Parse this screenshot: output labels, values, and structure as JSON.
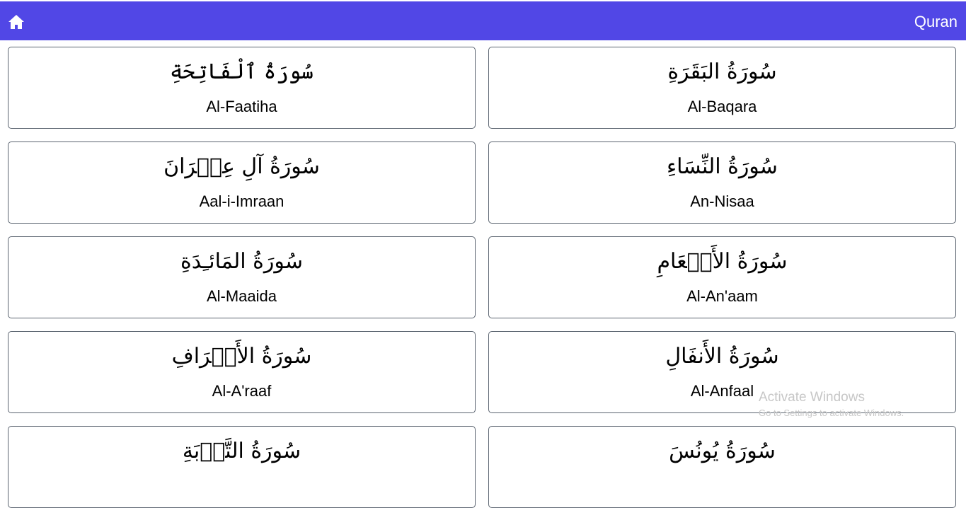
{
  "header": {
    "home_icon": "home-icon",
    "title": "Quran",
    "background": "#5147e6"
  },
  "surahs": [
    {
      "arabic": "سُورَةُ ٱلْفَاتِحَةِ",
      "name": "Al-Faatiha"
    },
    {
      "arabic": "سُورَةُ البَقَرَةِ",
      "name": "Al-Baqara"
    },
    {
      "arabic": "سُورَةُ آلِ عِمۡرَانَ",
      "name": "Aal-i-Imraan"
    },
    {
      "arabic": "سُورَةُ النِّسَاءِ",
      "name": "An-Nisaa"
    },
    {
      "arabic": "سُورَةُ المَائـِدَةِ",
      "name": "Al-Maaida"
    },
    {
      "arabic": "سُورَةُ الأَنۡعَامِ",
      "name": "Al-An'aam"
    },
    {
      "arabic": "سُورَةُ الأَعۡرَافِ",
      "name": "Al-A'raaf"
    },
    {
      "arabic": "سُورَةُ الأَنفَالِ",
      "name": "Al-Anfaal"
    },
    {
      "arabic": "سُورَةُ التَّوۡبَةِ",
      "name": ""
    },
    {
      "arabic": "سُورَةُ يُونُسَ",
      "name": ""
    }
  ],
  "watermark": {
    "title": "Activate Windows",
    "subtitle": "Go to Settings to activate Windows."
  }
}
